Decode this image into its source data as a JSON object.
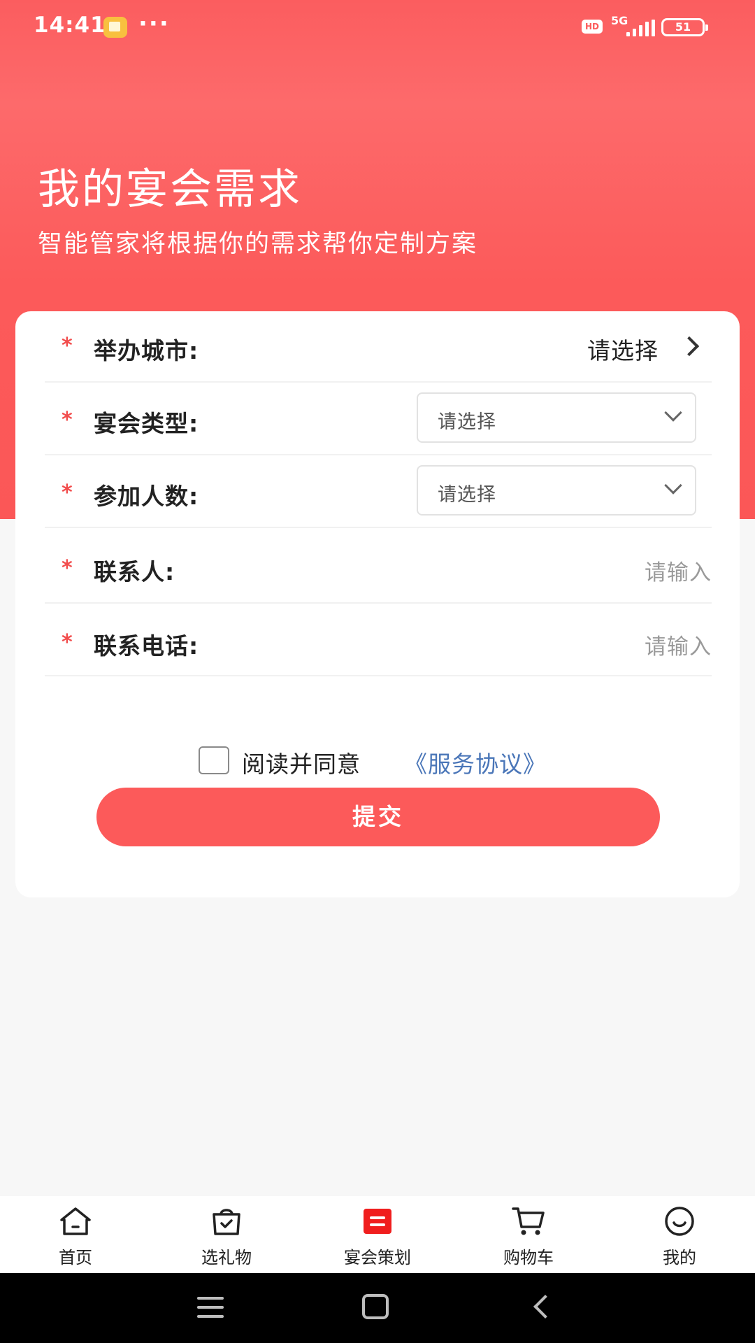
{
  "status_bar": {
    "time": "14:41",
    "dots": "···",
    "hd": "HD",
    "network": "5G",
    "battery": "51"
  },
  "header": {
    "title": "我的宴会需求",
    "subtitle": "智能管家将根据你的需求帮你定制方案"
  },
  "form": {
    "required_mark": "*",
    "city": {
      "label": "举办城市:",
      "value": "请选择"
    },
    "banquet_type": {
      "label": "宴会类型:",
      "placeholder": "请选择"
    },
    "guest_count": {
      "label": "参加人数:",
      "placeholder": "请选择"
    },
    "contact": {
      "label": "联系人:",
      "placeholder": "请输入"
    },
    "phone": {
      "label": "联系电话:",
      "placeholder": "请输入"
    }
  },
  "agreement": {
    "text": "阅读并同意",
    "link": "《服务协议》"
  },
  "submit_label": "提交",
  "tabs": [
    {
      "label": "首页",
      "icon": "home-icon"
    },
    {
      "label": "选礼物",
      "icon": "gift-bag-icon"
    },
    {
      "label": "宴会策划",
      "icon": "banquet-plan-icon",
      "active": true
    },
    {
      "label": "购物车",
      "icon": "cart-icon"
    },
    {
      "label": "我的",
      "icon": "profile-smile-icon"
    }
  ],
  "colors": {
    "primary": "#fc5a5a",
    "link": "#4a76b8",
    "active_tab": "#f01e1e"
  }
}
